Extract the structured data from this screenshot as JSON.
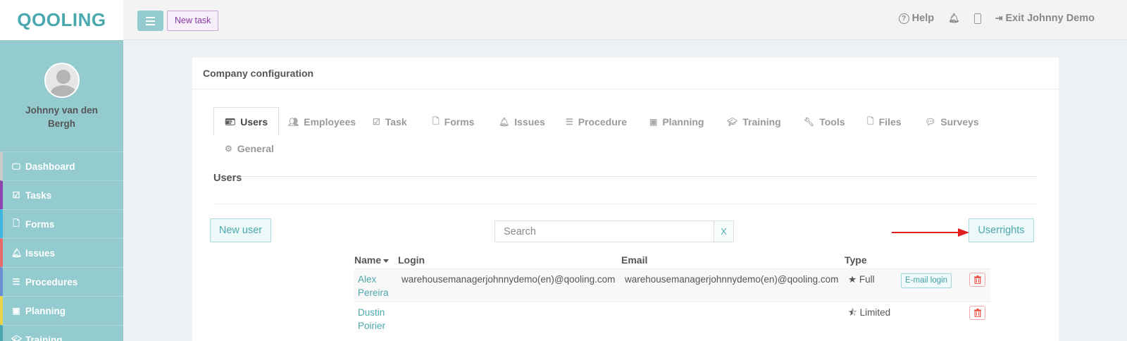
{
  "app": {
    "logo": "QOOLING"
  },
  "profile": {
    "name": "Johnny van den Bergh"
  },
  "sidebar": {
    "items": [
      {
        "label": "Dashboard",
        "icon": "monitor-icon",
        "color": "#cccccc"
      },
      {
        "label": "Tasks",
        "icon": "checkbox-icon",
        "color": "#8e44ad"
      },
      {
        "label": "Forms",
        "icon": "file-icon",
        "color": "#3fb6e0"
      },
      {
        "label": "Issues",
        "icon": "bell-icon",
        "color": "#e86a6a"
      },
      {
        "label": "Procedures",
        "icon": "list-icon",
        "color": "#6a8fd1"
      },
      {
        "label": "Planning",
        "icon": "calendar-check-icon",
        "color": "#e8d34a"
      },
      {
        "label": "Training",
        "icon": "graduation-cap-icon",
        "color": "#4aa9ae"
      }
    ]
  },
  "topbar": {
    "new_task": "New task",
    "help": "Help",
    "exit": "Exit Johnny Demo"
  },
  "panel": {
    "title": "Company configuration",
    "tabs": [
      {
        "label": "Users",
        "icon": "id-card-icon",
        "active": true
      },
      {
        "label": "Employees",
        "icon": "users-icon"
      },
      {
        "label": "Task",
        "icon": "checkbox-icon"
      },
      {
        "label": "Forms",
        "icon": "file-icon"
      },
      {
        "label": "Issues",
        "icon": "bell-icon"
      },
      {
        "label": "Procedure",
        "icon": "list-icon"
      },
      {
        "label": "Planning",
        "icon": "calendar-check-icon"
      },
      {
        "label": "Training",
        "icon": "graduation-cap-icon"
      },
      {
        "label": "Tools",
        "icon": "wrench-icon"
      },
      {
        "label": "Files",
        "icon": "file-icon"
      },
      {
        "label": "Surveys",
        "icon": "comment-icon"
      },
      {
        "label": "General",
        "icon": "gear-icon"
      }
    ],
    "section_title": "Users",
    "new_user": "New user",
    "search_placeholder": "Search",
    "search_clear": "X",
    "userrights": "Userrights"
  },
  "table": {
    "headers": {
      "name": "Name",
      "login": "Login",
      "email": "Email",
      "type": "Type"
    },
    "rows": [
      {
        "first": "Alex",
        "last": "Pereira",
        "login": "warehousemanagerjohnnydemo(en)@qooling.com",
        "email": "warehousemanagerjohnnydemo(en)@qooling.com",
        "type": "Full",
        "type_icon": "star-icon",
        "badge": "E-mail login"
      },
      {
        "first": "Dustin",
        "last": "Poirier",
        "login": "",
        "email": "",
        "type": "Limited",
        "type_icon": "star-half-icon",
        "badge": ""
      }
    ]
  },
  "colors": {
    "accent": "#4aa9ae",
    "sidebar": "#93cbcf",
    "danger": "#e74c3c",
    "arrow": "#e02020"
  }
}
